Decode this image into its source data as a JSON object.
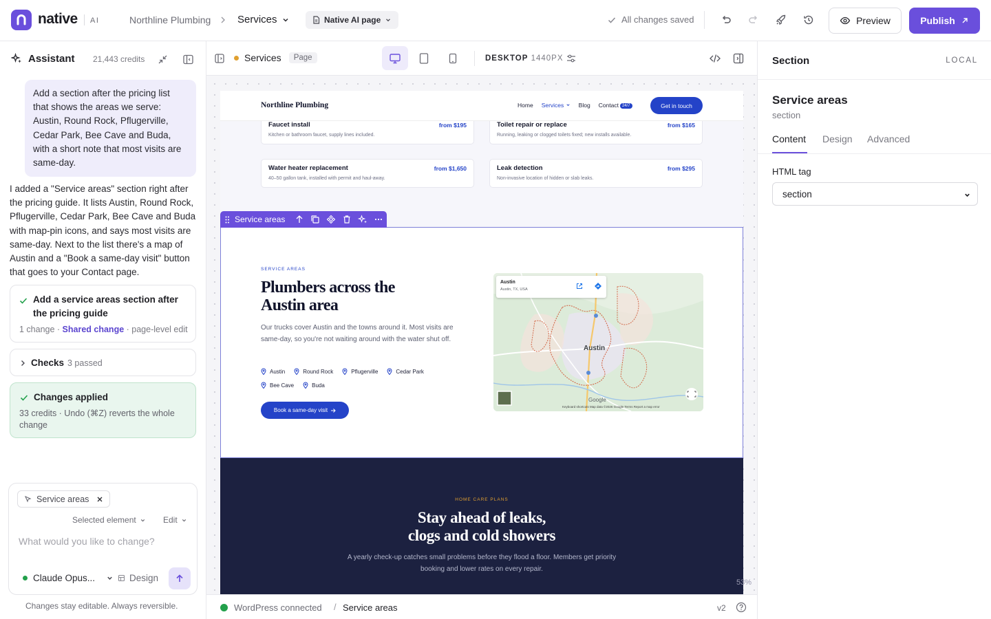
{
  "app": {
    "name": "native",
    "ai_tag": "AI"
  },
  "topbar": {
    "site": "Northline Plumbing",
    "page": "Services",
    "page_type": "Native AI page",
    "saved_status": "All changes saved",
    "preview_label": "Preview",
    "publish_label": "Publish"
  },
  "assistant": {
    "title": "Assistant",
    "credits": "21,443 credits",
    "user_message": "Add a section after the pricing list that shows the areas we serve: Austin, Round Rock, Pflugerville, Cedar Park, Bee Cave and Buda, with a short note that most visits are same-day.",
    "ai_message": "I added a \"Service areas\" section right after the pricing guide. It lists Austin, Round Rock, Pflugerville, Cedar Park, Bee Cave and Buda with map-pin icons, and says most visits are same-day. Next to the list there's a map of Austin and a \"Book a same-day visit\" button that goes to your Contact page.",
    "change_card": {
      "title": "Add a service areas section after the pricing guide",
      "count": "1 change",
      "sep1": " · ",
      "link": "Shared change",
      "sep2": " · ",
      "scope": "page-level edit"
    },
    "checks": {
      "title": "Checks",
      "summary": "3 passed"
    },
    "applied": {
      "title": "Changes applied",
      "detail": "33 credits · Undo (⌘Z) reverts the whole change"
    },
    "composer": {
      "chip": "Service areas",
      "scope": "Selected element",
      "mode": "Edit",
      "placeholder": "What would you like to change?",
      "model": "Claude Opus...",
      "design_toggle": "Design"
    },
    "footer": "Changes stay editable. Always reversible."
  },
  "canvas_toolbar": {
    "page_name": "Services",
    "page_badge": "Page",
    "device_label": "DESKTOP",
    "device_width": "1440PX"
  },
  "site": {
    "brand": "Northline Plumbing",
    "nav": [
      "Home",
      "Services",
      "Blog",
      "Contact"
    ],
    "nav_badge": "24/7",
    "cta": "Get in touch",
    "pricing": [
      {
        "name": "Faucet install",
        "price": "from $195",
        "desc": "Kitchen or bathroom faucet, supply lines included."
      },
      {
        "name": "Toilet repair or replace",
        "price": "from $165",
        "desc": "Running, leaking or clogged toilets fixed; new installs available."
      },
      {
        "name": "Water heater replacement",
        "price": "from $1,650",
        "desc": "40–50 gallon tank, installed with permit and haul-away."
      },
      {
        "name": "Leak detection",
        "price": "from $295",
        "desc": "Non-invasive location of hidden or slab leaks."
      }
    ],
    "service_areas": {
      "eyebrow": "SERVICE AREAS",
      "title": "Plumbers across the Austin area",
      "desc": "Our trucks cover Austin and the towns around it. Most visits are same-day, so you're not waiting around with the water shut off.",
      "cities": [
        "Austin",
        "Round Rock",
        "Pflugerville",
        "Cedar Park",
        "Bee Cave",
        "Buda"
      ],
      "button": "Book a same-day visit",
      "map": {
        "place": "Austin",
        "address": "Austin, TX, USA",
        "city_label": "Austin",
        "google": "Google",
        "attribution": "Keyboard shortcuts   Map data ©2026 Google   Terms   Report a map error"
      }
    },
    "plans": {
      "eyebrow": "HOME CARE PLANS",
      "title_line1": "Stay ahead of leaks,",
      "title_line2": "clogs and cold showers",
      "desc": "A yearly check-up catches small problems before they flood a floor. Members get priority booking and lower rates on every repair."
    }
  },
  "section_toolbar": {
    "label": "Service areas"
  },
  "zoom": "53%",
  "status_bar": {
    "connection": "WordPress connected",
    "sep": "/",
    "element": "Service areas",
    "version": "v2"
  },
  "inspector": {
    "header": "Section",
    "scope": "LOCAL",
    "name": "Service areas",
    "type": "section",
    "tabs": [
      "Content",
      "Design",
      "Advanced"
    ],
    "field_label": "HTML tag",
    "field_value": "section"
  },
  "colors": {
    "accent": "#6a4fdc",
    "site_primary": "#2443c8",
    "site_dark": "#1c2140",
    "success": "#22a04b"
  }
}
